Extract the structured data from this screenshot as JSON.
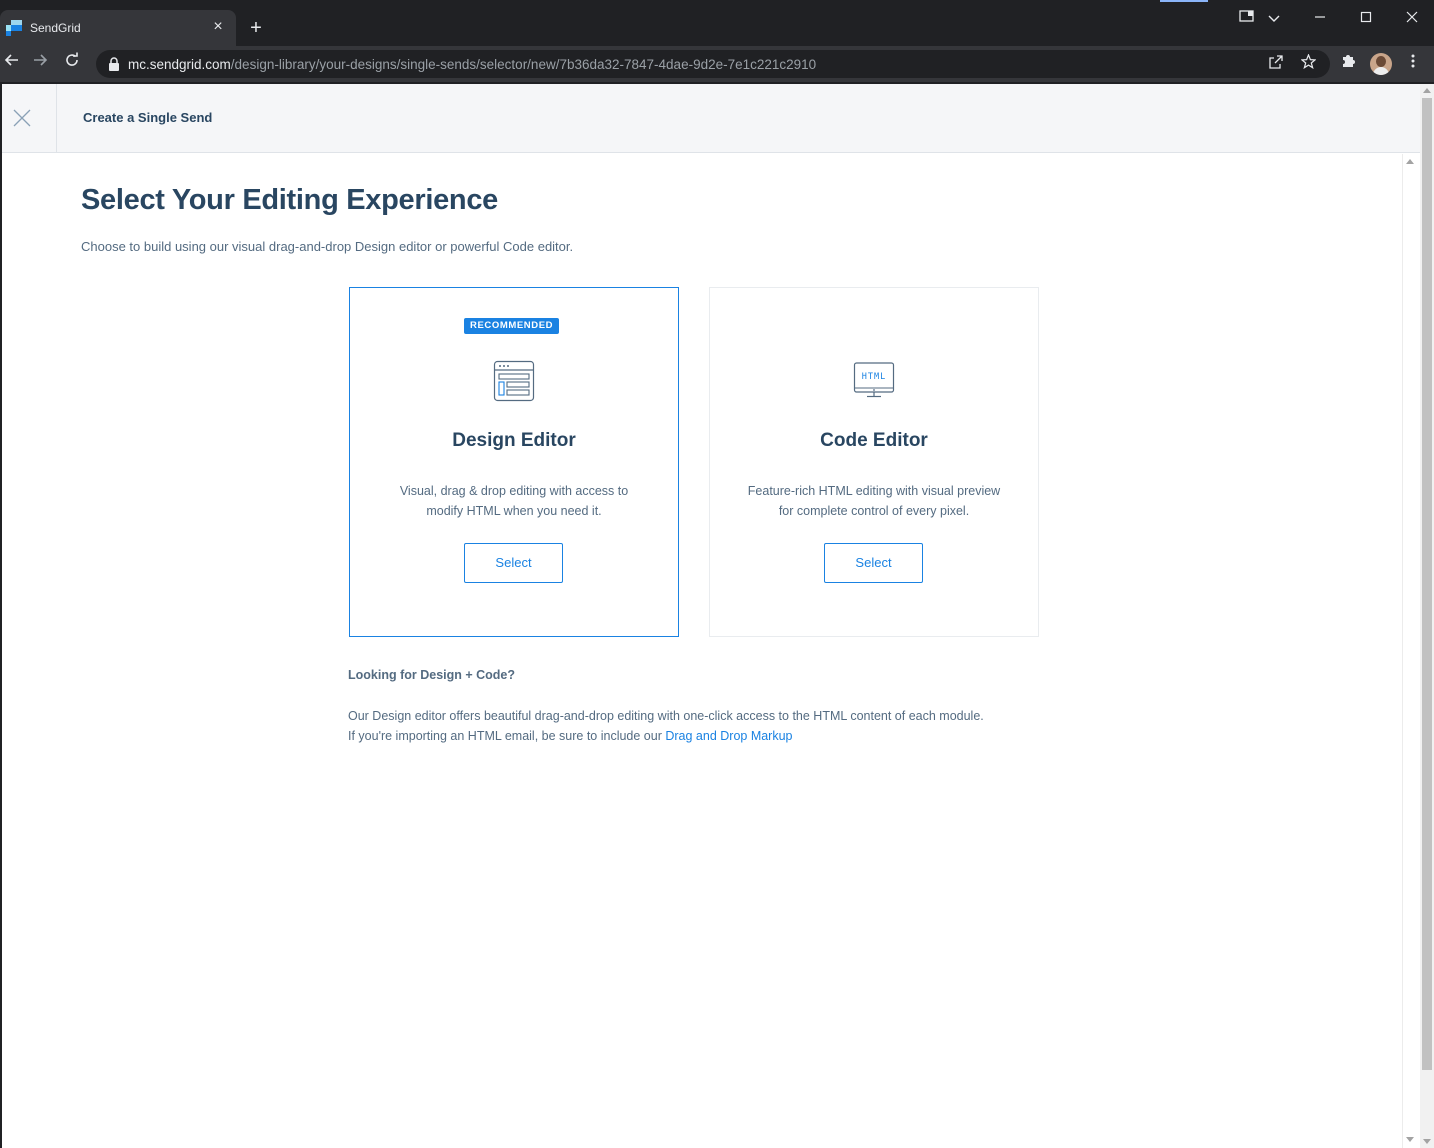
{
  "browser": {
    "tab_title": "SendGrid",
    "tab_close": "×",
    "new_tab": "+",
    "url_host": "mc.sendgrid.com",
    "url_path": "/design-library/your-designs/single-sends/selector/new/7b36da32-7847-4dae-9d2e-7e1c221c2910",
    "icons": [
      "back-icon",
      "forward-icon",
      "reload-icon",
      "lock-icon",
      "share-icon",
      "star-icon",
      "extensions-icon",
      "menu-icon"
    ],
    "window_controls": [
      "minimize",
      "maximize",
      "close"
    ]
  },
  "header": {
    "title": "Create a Single Send"
  },
  "main": {
    "title": "Select Your Editing Experience",
    "subtitle": "Choose to build using our visual drag-and-drop Design editor or powerful Code editor.",
    "cards": [
      {
        "badge": "RECOMMENDED",
        "title": "Design Editor",
        "description": "Visual, drag & drop editing with access to modify HTML when you need it.",
        "button": "Select",
        "selected": true
      },
      {
        "icon_text": "HTML",
        "title": "Code Editor",
        "description": "Feature-rich HTML editing with visual preview for complete control of every pixel.",
        "button": "Select",
        "selected": false
      }
    ],
    "design_code": {
      "title": "Looking for Design + Code?",
      "text_line1": "Our Design editor offers beautiful drag-and-drop editing with one-click access to the HTML content of each module.",
      "text_line2": "If you're importing an HTML email, be sure to include our ",
      "link": "Drag and Drop Markup"
    }
  },
  "colors": {
    "accent": "#1a82e2",
    "heading": "#294661",
    "body_text": "#546b81"
  }
}
